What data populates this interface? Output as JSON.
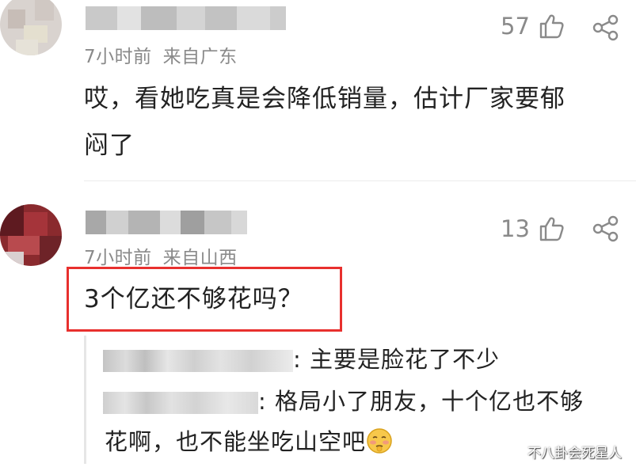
{
  "comments": [
    {
      "time": "7小时前",
      "location": "来自广东",
      "likes": "57",
      "text_line1": "哎，看她吃真是会降低销量，估计厂家要郁",
      "text_line2": "闷了"
    },
    {
      "time": "7小时前",
      "location": "来自山西",
      "likes": "13",
      "text": "3个亿还不够花吗？",
      "replies": [
        {
          "text": ": 主要是脸花了不少"
        },
        {
          "text_line1": ": 格局小了朋友，十个亿也不够",
          "text_line2": "花啊，也不能坐吃山空吧"
        }
      ]
    }
  ],
  "watermark": "不八卦会死星人",
  "icons": {
    "like": "thumbs-up-icon",
    "share": "share-icon",
    "emoji": "shy-face-emoji"
  },
  "colors": {
    "highlight": "#e8302e",
    "meta": "#8a8a8a",
    "text": "#222222"
  }
}
